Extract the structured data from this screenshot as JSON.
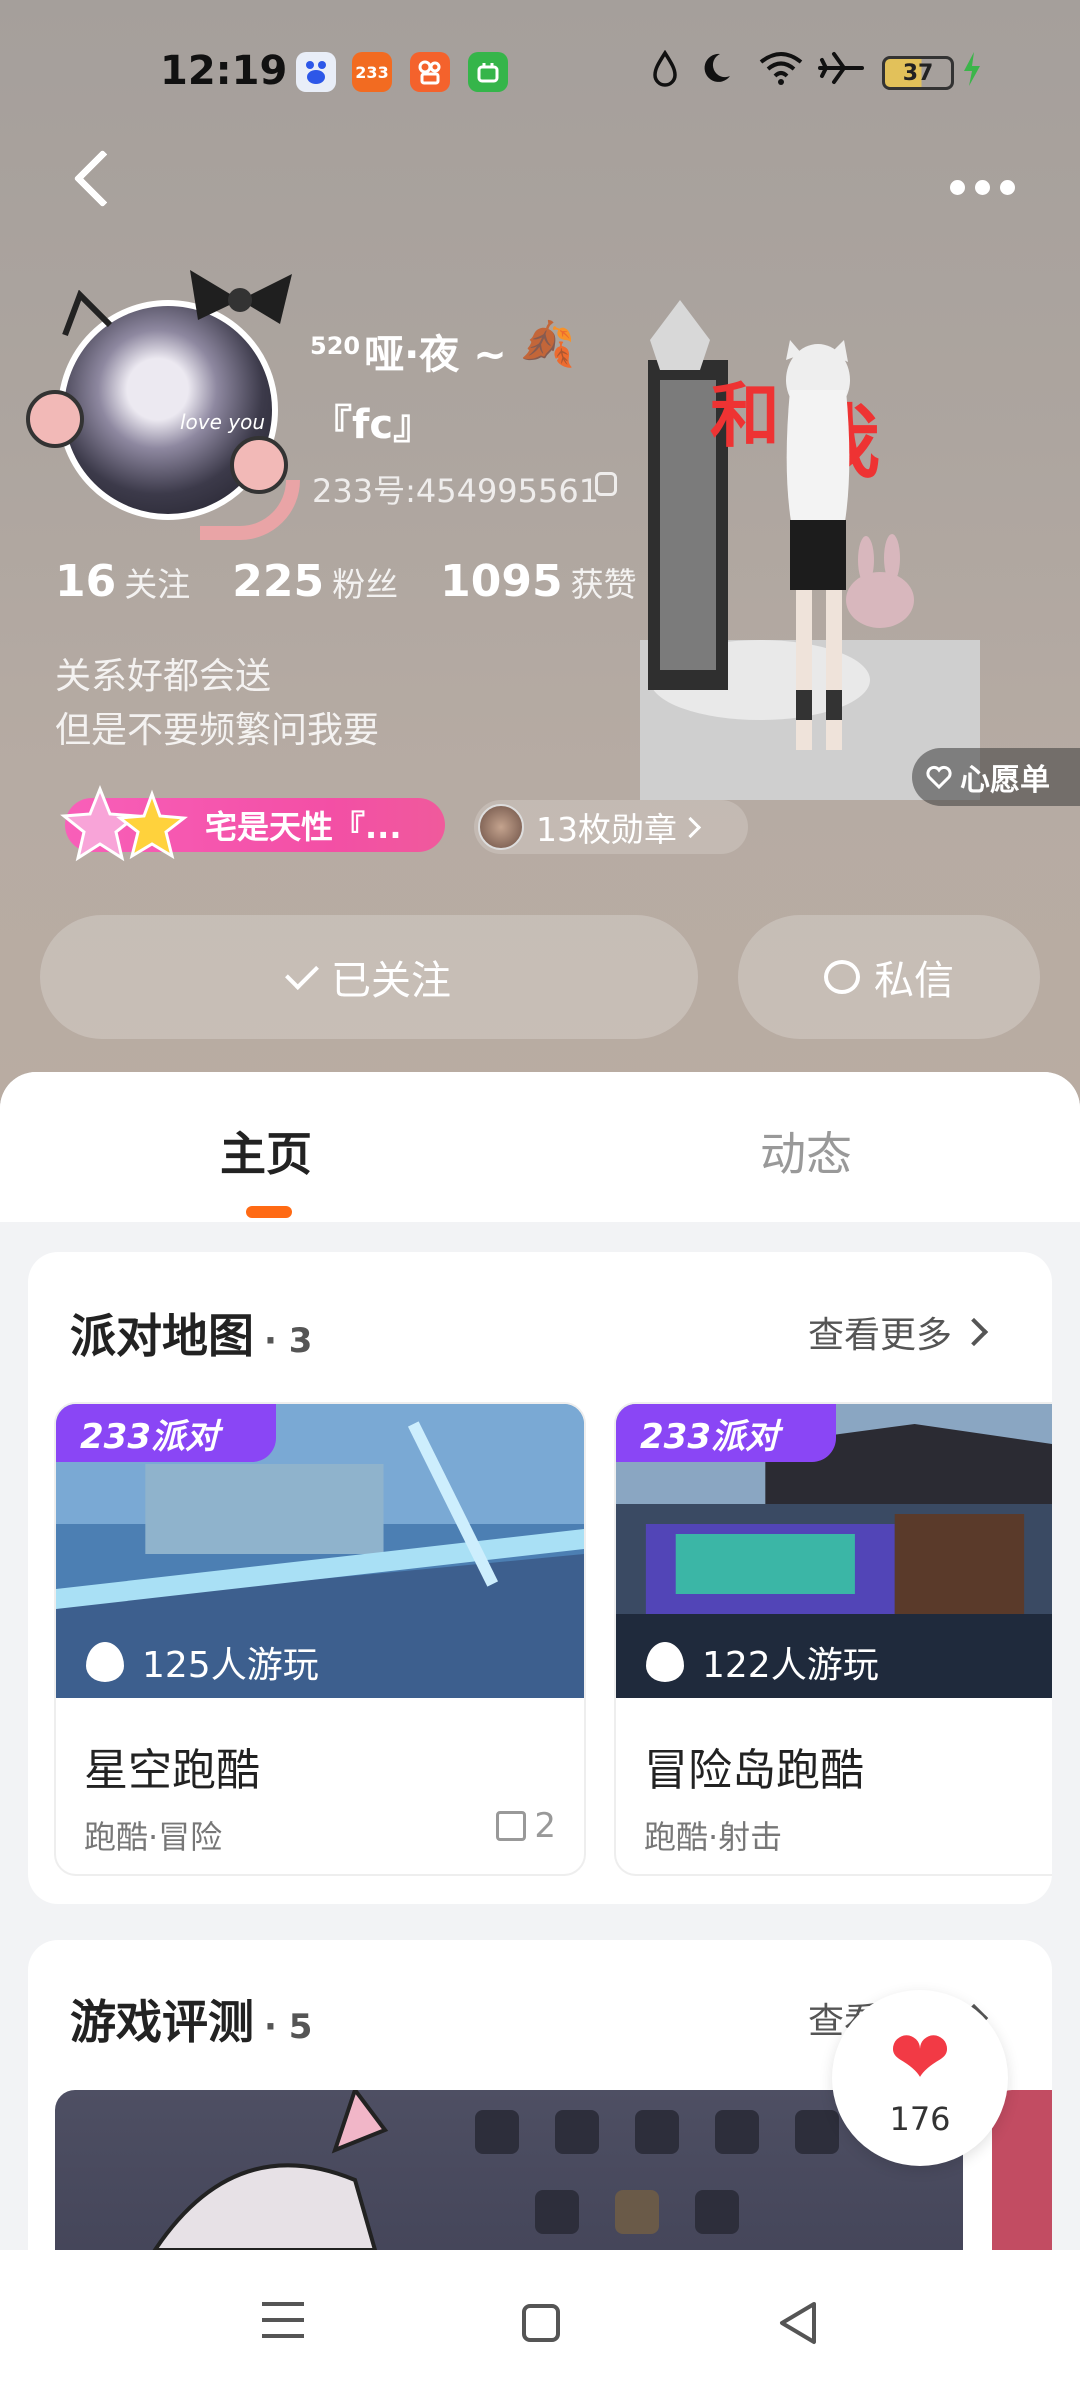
{
  "status_bar": {
    "time": "12:19",
    "app_icons": [
      "baidu-icon",
      "233-icon",
      "kuaishou-icon",
      "wechat-icon"
    ],
    "app_233_label": "233",
    "battery": "37"
  },
  "profile": {
    "name_prefix": "520",
    "name_line1": "哑·夜 ~",
    "name_line2": "『fc』",
    "uid": "233号:454995561",
    "stats": [
      {
        "value": "16",
        "label": "关注"
      },
      {
        "value": "225",
        "label": "粉丝"
      },
      {
        "value": "1095",
        "label": "获赞"
      }
    ],
    "bio_line1": "关系好都会送",
    "bio_line2": "但是不要频繁问我要",
    "title_badge": "宅是天性『...",
    "medals": "13枚勋章",
    "wishlist": "心愿单",
    "follow_btn": "已关注",
    "message_btn": "私信",
    "avatar_caption": "love you"
  },
  "tabs": [
    "主页",
    "动态"
  ],
  "party_maps": {
    "title": "派对地图",
    "count": "· 3",
    "see_more": "查看更多",
    "tag_label": "233派对",
    "items": [
      {
        "name": "星空跑酷",
        "players": "125人游玩",
        "tags": "跑酷·冒险",
        "likes": "2"
      },
      {
        "name": "冒险岛跑酷",
        "players": "122人游玩",
        "tags": "跑酷·射击",
        "likes": ""
      }
    ]
  },
  "reviews": {
    "title": "游戏评测",
    "count": "· 5",
    "see_more": "查看更多"
  },
  "floating_like": {
    "count": "176"
  },
  "colors": {
    "accent": "#ff6a14",
    "party_tag": "#8a46f5",
    "badge_pink": "#f34fa5",
    "heart": "#f23a45"
  }
}
